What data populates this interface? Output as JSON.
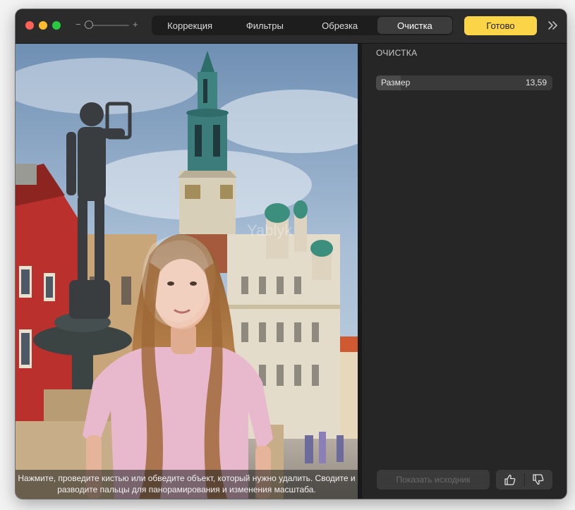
{
  "toolbar": {
    "zoom_minus": "−",
    "zoom_plus": "+",
    "tabs": [
      {
        "label": "Коррекция",
        "active": false
      },
      {
        "label": "Фильтры",
        "active": false
      },
      {
        "label": "Обрезка",
        "active": false
      },
      {
        "label": "Очистка",
        "active": true
      }
    ],
    "done_label": "Готово",
    "expand_icon": "chevrons-right-icon"
  },
  "photo": {
    "hint": "Нажмите, проведите кистью или обведите объект, который нужно удалить. Сводите и разводите пальцы для панорамирования и изменения масштаба.",
    "watermark": "Yablyk"
  },
  "sidebar": {
    "title": "ОЧИСТКА",
    "size_label": "Размер",
    "size_value": "13,59",
    "size_fill_percent": 14,
    "bottom_button_label": "Показать исходник",
    "thumbs_up_icon": "thumbs-up-icon",
    "thumbs_down_icon": "thumbs-down-icon"
  },
  "colors": {
    "accent": "#fcd447",
    "window_bg": "#262626",
    "titlebar_bg": "#2b2b2b"
  }
}
